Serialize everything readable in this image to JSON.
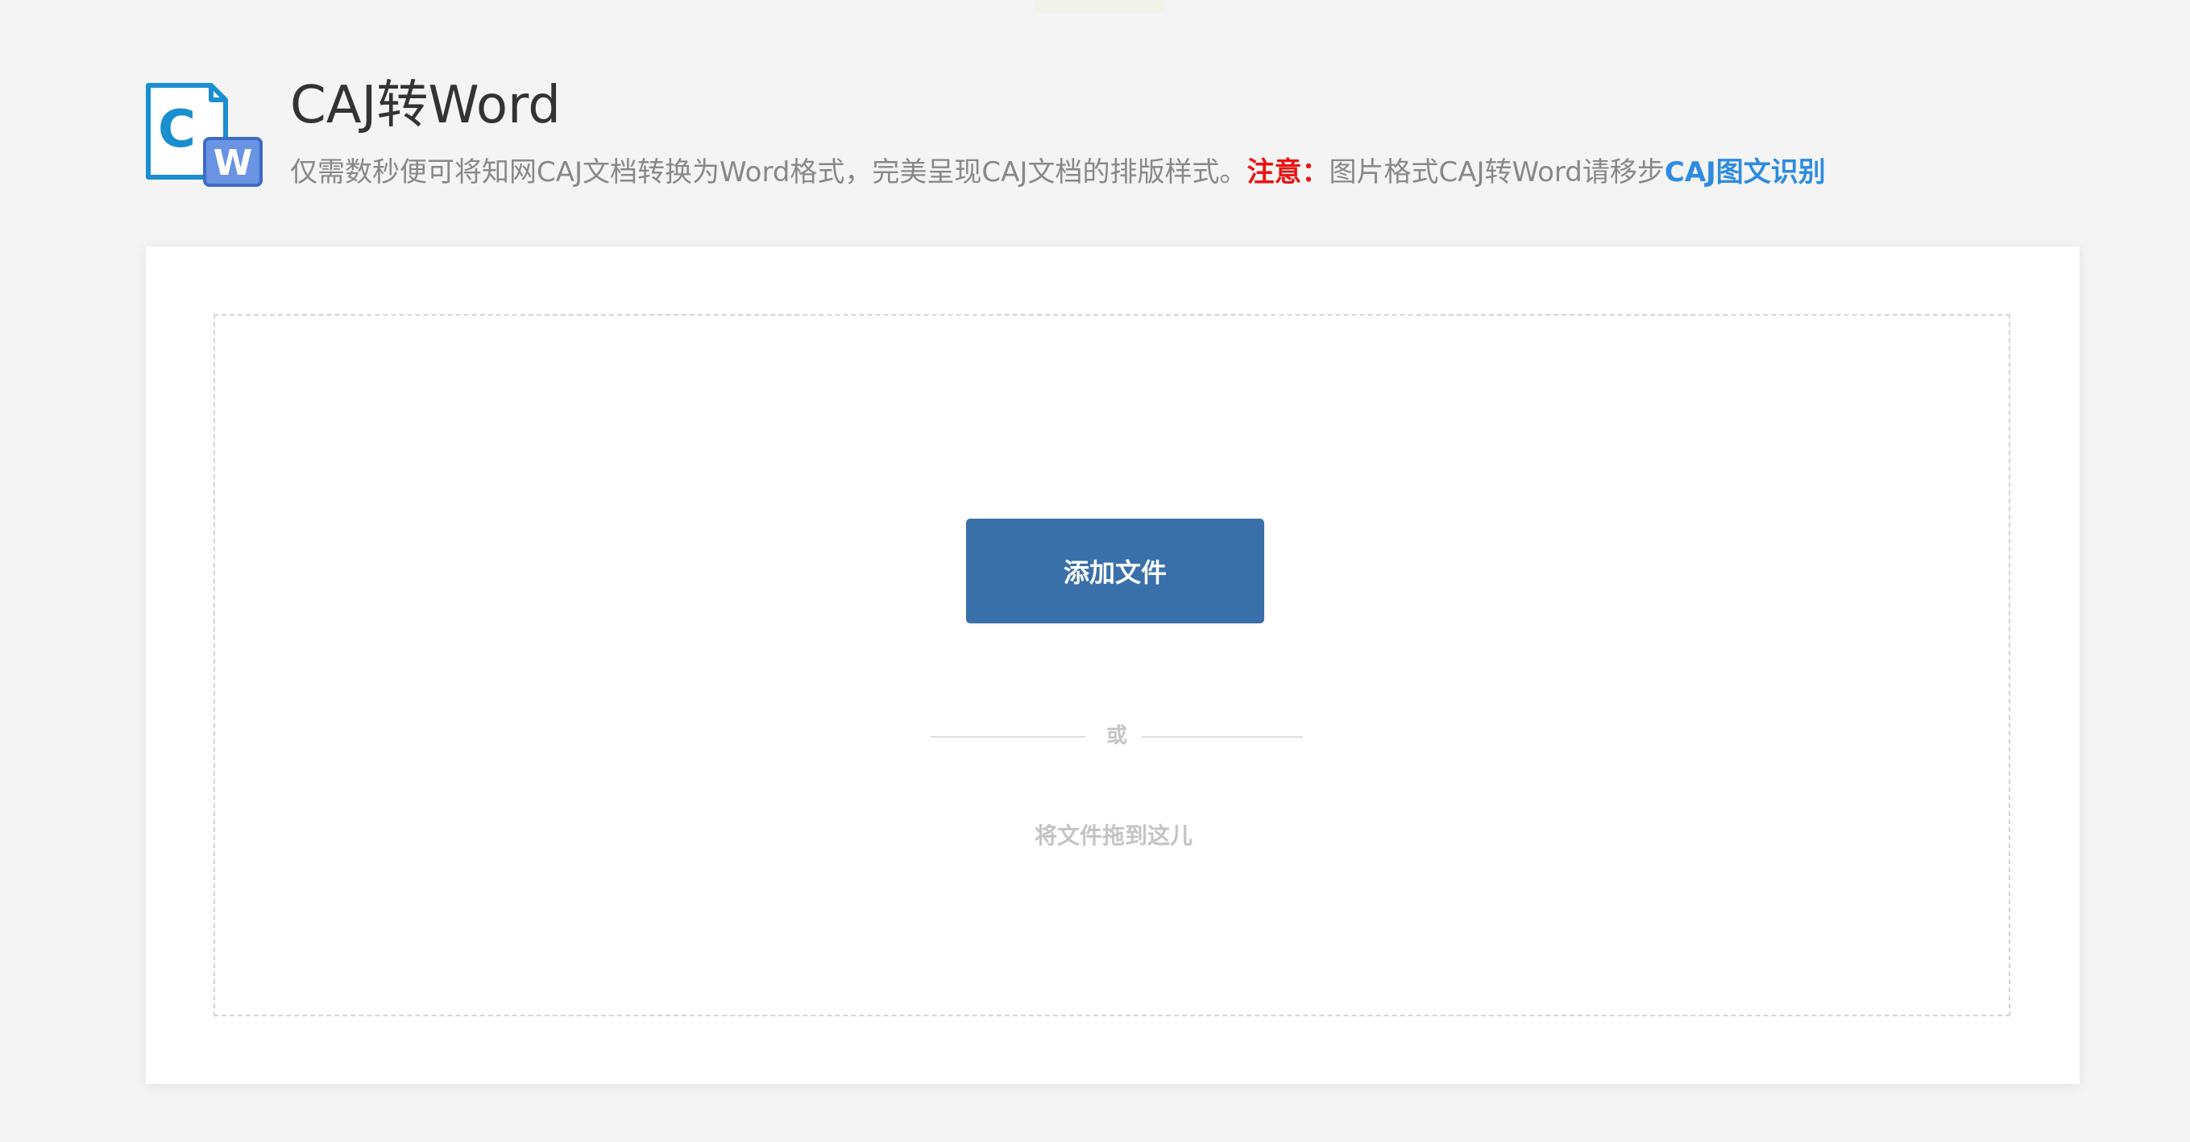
{
  "header": {
    "title": "CAJ转Word",
    "description": "仅需数秒便可将知网CAJ文档转换为Word格式，完美呈现CAJ文档的排版样式。",
    "note_label": "注意：",
    "note_text": "图片格式CAJ转Word请移步",
    "note_link": "CAJ图文识别",
    "logo_icon": "caj-to-word-icon",
    "logo_letter_c": "C",
    "logo_letter_w": "W"
  },
  "upload": {
    "add_button_label": "添加文件",
    "or_text": "或",
    "drop_hint": "将文件拖到这儿"
  },
  "colors": {
    "background": "#f4f4f4",
    "button": "#3a70aa",
    "note_red": "#ee1111",
    "link_blue": "#2d8be0",
    "logo_blue": "#1a8fd0",
    "logo_w_badge": "#6b93e3"
  }
}
